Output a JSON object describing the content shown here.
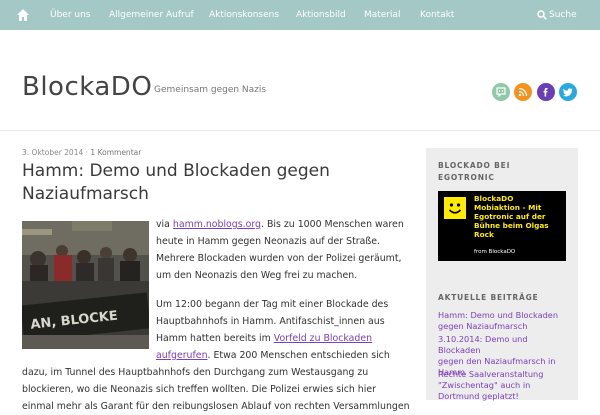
{
  "nav": {
    "home_icon": "home-icon",
    "items": [
      "Über uns",
      "Allgemeiner Aufruf",
      "Aktionskonsens",
      "Aktionsbild",
      "Material",
      "Kontakt"
    ],
    "search_label": "Suche",
    "search_icon": "search-icon"
  },
  "header": {
    "site_title": "BlockaDO",
    "tagline": "Gemeinsam gegen Nazis",
    "social": [
      "speech-bubble-icon",
      "rss-icon",
      "facebook-icon",
      "twitter-icon"
    ]
  },
  "post": {
    "date": "3. Oktober 2014",
    "sep": "·",
    "comments": "1 Kommentar",
    "title_line1": "Hamm: Demo und Blockaden gegen",
    "title_line2": "Naziaufmarsch",
    "p1": {
      "via": "via ",
      "via_link": "hamm.noblogs.org",
      "l1_rest": ". Bis zu 1000 Menschen waren",
      "l2": "heute in Hamm gegen Neonazis auf der Straße.",
      "l3": "Mehrere Blockaden wurden von der Polizei geräumt,",
      "l4": "um den Neonazis den Weg frei zu machen."
    },
    "p2": {
      "l1": "Um 12:00 begann der Tag mit einer Blockade des",
      "l2": "Hauptbahnhofs in Hamm. Antifaschist_innen aus",
      "l3_start": "Hamm hatten bereits im ",
      "l3_link": "Vorfeld zu Blockaden",
      "l4_link": "aufgerufen",
      "l4_rest": ". Etwa 200 Menschen entschieden sich",
      "l5": "dazu, im Tunnel des Hauptbahnhofs den Durchgang zum Westausgang zu",
      "l6": "blockieren, wo die Neonazis sich treffen wollten. Die Polizei erwies sich hier",
      "l7": "einmal mehr als Garant für den reibungslosen Ablauf von rechten Versammlungen"
    }
  },
  "sidebar": {
    "widget1_title_l1": "BLOCKADO BEI",
    "widget1_title_l2": "EGOTRONIC",
    "promo": {
      "l1": "BlockaDO",
      "l2": "Mobiaktion - Mit",
      "l3": "Egotronic auf der",
      "l4": "Bühne beim Olgas",
      "l5": "Rock",
      "from": "from BlockaDO"
    },
    "widget2_title": "AKTUELLE BEITRÄGE",
    "recent": [
      {
        "l1": "Hamm: Demo und Blockaden",
        "l2": "gegen Naziaufmarsch"
      },
      {
        "l1": "3.10.2014: Demo und Blockaden",
        "l2": "gegen den Naziaufmarsch in",
        "l3": "Hamm"
      },
      {
        "l1": "Rechte Saalveranstaltung",
        "l2": "\"Zwischentag\" auch in",
        "l3": "Dortmund geplatzt!"
      }
    ]
  },
  "colors": {
    "nav_bg": "#a3c8c5",
    "link": "#7b3fb8",
    "promo_bg": "#000000",
    "promo_text": "#ffeb00",
    "speech_green": "#8fc9a8",
    "rss_orange": "#f5921e",
    "facebook_purple": "#6a3fb5",
    "twitter_blue": "#29a9e1"
  }
}
